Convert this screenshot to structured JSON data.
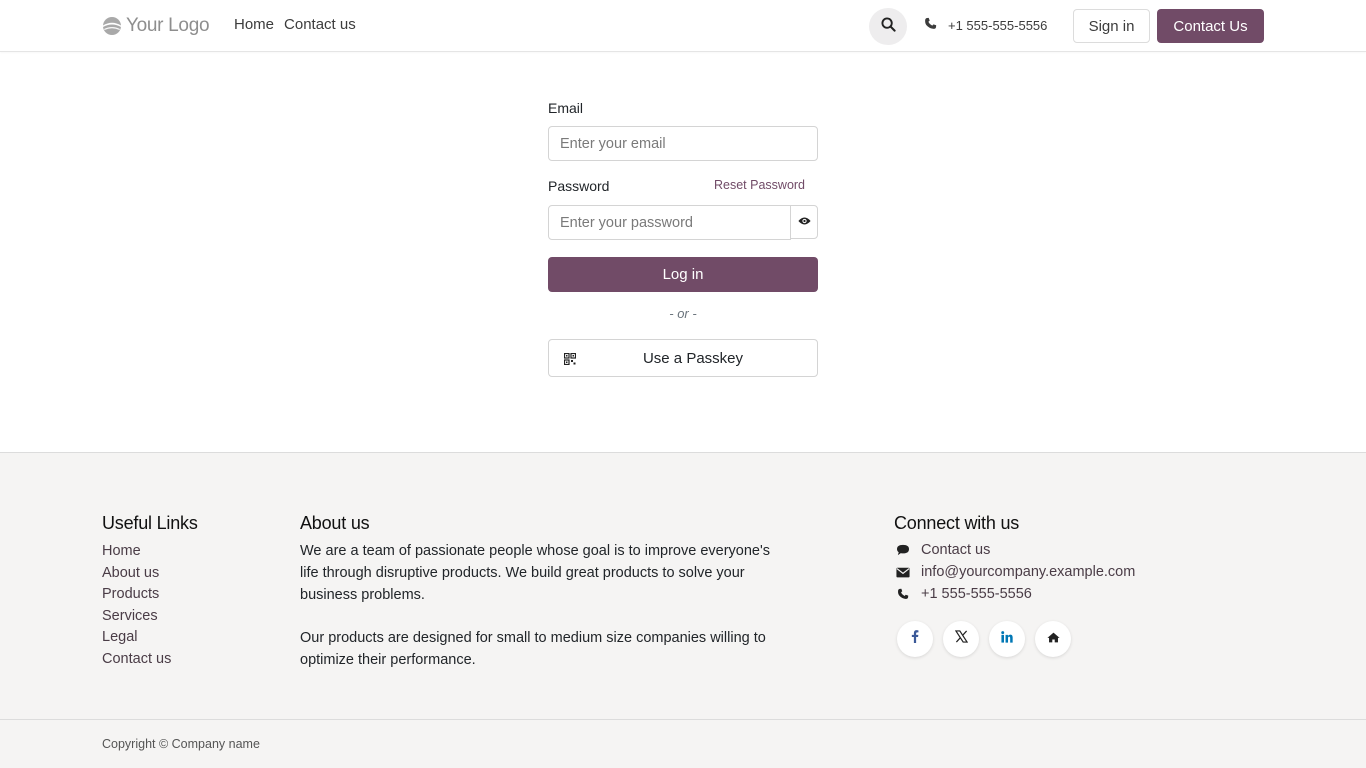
{
  "header": {
    "logo_text": "Your Logo",
    "nav": [
      "Home",
      "Contact us"
    ],
    "phone": "+1 555-555-5556",
    "signin_label": "Sign in",
    "contact_label": "Contact Us"
  },
  "login": {
    "email_label": "Email",
    "email_placeholder": "Enter your email",
    "password_label": "Password",
    "reset_label": "Reset Password",
    "password_placeholder": "Enter your password",
    "login_label": "Log in",
    "or_text": "- or -",
    "passkey_label": "Use a Passkey"
  },
  "footer": {
    "useful_links_title": "Useful Links",
    "useful_links": [
      "Home",
      "About us",
      "Products",
      "Services",
      "Legal",
      "Contact us"
    ],
    "about_title": "About us",
    "about_p1": "We are a team of passionate people whose goal is to improve everyone's life through disruptive products. We build great products to solve your business problems.",
    "about_p2": "Our products are designed for small to medium size companies willing to optimize their performance.",
    "connect_title": "Connect with us",
    "connect_items": [
      {
        "icon": "comment-icon",
        "text": "Contact us"
      },
      {
        "icon": "envelope-icon",
        "text": "info@yourcompany.example.com"
      },
      {
        "icon": "phone-icon",
        "text": "+1 555-555-5556"
      }
    ],
    "social": [
      "facebook-icon",
      "x-twitter-icon",
      "linkedin-icon",
      "home-icon"
    ],
    "copyright": "Copyright © Company name"
  },
  "colors": {
    "brand": "#714b67",
    "footer_bg": "#f5f4f3",
    "facebook": "#3b5998",
    "linkedin": "#0077b5"
  }
}
